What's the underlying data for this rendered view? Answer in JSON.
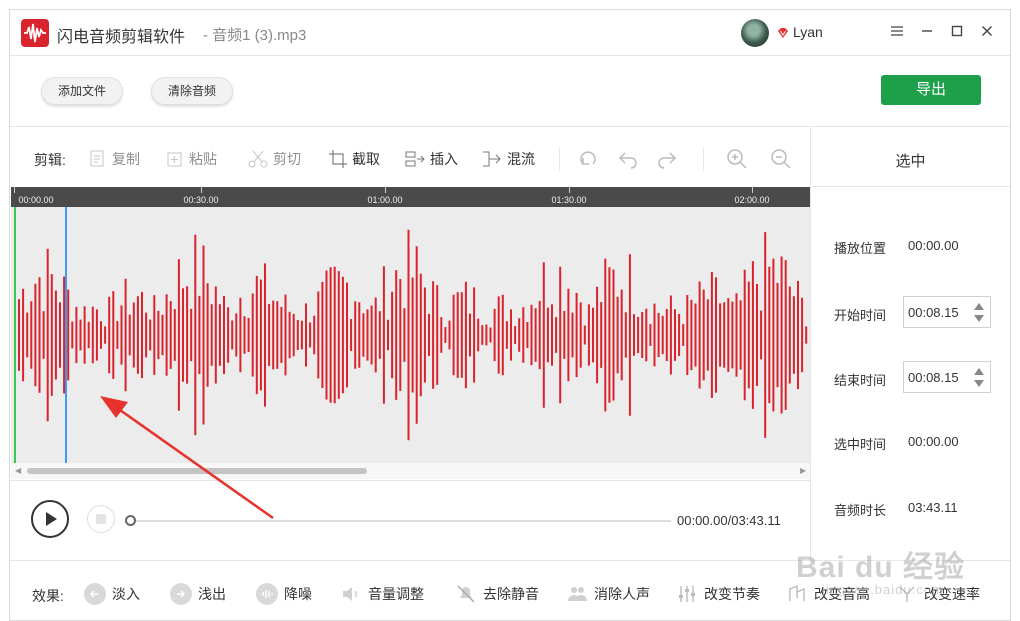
{
  "app": {
    "title": "闪电音频剪辑软件",
    "file_name": "- 音频1 (3).mp3",
    "username": "Lyan",
    "window_controls": [
      "minimize-icon",
      "maximize-icon",
      "close-icon"
    ],
    "menu_icon": "hamburger-icon"
  },
  "top_buttons": {
    "add_file": "添加文件",
    "clear_audio": "清除音频",
    "export": "导出"
  },
  "toolbar": {
    "label": "剪辑:",
    "copy": "复制",
    "paste": "粘贴",
    "cut": "剪切",
    "crop": "截取",
    "insert": "插入",
    "mix": "混流",
    "icons": [
      "redo-circle-icon",
      "undo-icon",
      "redo-icon",
      "zoom-in-icon",
      "zoom-out-icon"
    ]
  },
  "timeline": {
    "ticks": [
      "00:00.00",
      "00:30.00",
      "01:00.00",
      "01:30.00",
      "02:00.00"
    ],
    "waveform_color": "#d9232d",
    "cursor_color": "#3b9cf0",
    "start_marker_color": "#3cc84a"
  },
  "player": {
    "time": "00:00.00/03:43.11",
    "progress": 0
  },
  "panel": {
    "header": "选中",
    "play_position_label": "播放位置",
    "play_position_value": "00:00.00",
    "start_time_label": "开始时间",
    "start_time_value": "00:08.15",
    "end_time_label": "结束时间",
    "end_time_value": "00:08.15",
    "selected_time_label": "选中时间",
    "selected_time_value": "00:00.00",
    "duration_label": "音频时长",
    "duration_value": "03:43.11"
  },
  "effects": {
    "label": "效果:",
    "fade_in": "淡入",
    "fade_out": "浅出",
    "denoise": "降噪",
    "volume": "音量调整",
    "remove_silence": "去除静音",
    "remove_vocals": "消除人声",
    "tempo": "改变节奏",
    "pitch": "改变音高",
    "speed": "改变速率"
  },
  "watermark": {
    "brand": "Bai du 经验",
    "url": "jingyan.baidu.com"
  },
  "colors": {
    "accent_green": "#1ea04b",
    "arrow_red": "#e8322d"
  }
}
